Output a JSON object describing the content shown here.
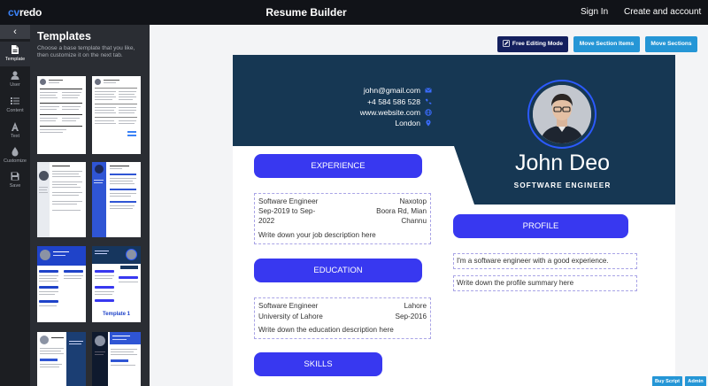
{
  "nav": {
    "logo_prefix": "cv",
    "logo_suffix": "redo",
    "title": "Resume Builder",
    "signin": "Sign In",
    "create_account": "Create and account"
  },
  "rail": {
    "collapse_icon": "chevron-left-icon",
    "items": [
      {
        "label": "Template",
        "icon": "file-icon",
        "active": true
      },
      {
        "label": "User",
        "icon": "user-icon",
        "active": false
      },
      {
        "label": "Content",
        "icon": "list-icon",
        "active": false
      },
      {
        "label": "Text",
        "icon": "text-icon",
        "active": false
      },
      {
        "label": "Customize",
        "icon": "droplet-icon",
        "active": false
      },
      {
        "label": "Save",
        "icon": "save-icon",
        "active": false
      }
    ]
  },
  "templates_panel": {
    "title": "Templates",
    "description": "Choose a base template that you like, then customize it on the next tab.",
    "thumbnail_caption": "Template 1"
  },
  "toolbar": {
    "free_editing": "Free Editing Mode",
    "move_items": "Move Section Items",
    "move_sections": "Move Sections"
  },
  "resume": {
    "email": "john@gmail.com",
    "phone": "+4 584 586 528",
    "website": "www.website.com",
    "location": "London",
    "name": "John Deo",
    "role": "SOFTWARE ENGINEER",
    "experience": {
      "heading": "EXPERIENCE",
      "position": "Software Engineer",
      "company": "Naxotop",
      "dates_line1": "Sep-2019 to Sep-",
      "dates_line2": "2022",
      "location_line1": "Boora Rd, Mian",
      "location_line2": "Channu",
      "description": "Write down your job description here"
    },
    "education": {
      "heading": "EDUCATION",
      "degree": "Software Engineer",
      "city": "Lahore",
      "school": "University of Lahore",
      "date": "Sep-2016",
      "description": "Write down the education description here"
    },
    "profile": {
      "heading": "PROFILE",
      "summary": "I'm a software engineer with a good experience.",
      "placeholder": "Write down the profile summary here"
    },
    "skills": {
      "heading": "SKILLS"
    }
  },
  "footer_buttons": {
    "buy_script": "Buy Script",
    "admin": "Admin"
  },
  "colors": {
    "header_dark": "#163753",
    "section_blue": "#3838f0",
    "toolbar_navy": "#14205e",
    "toolbar_blue": "#2596d6"
  }
}
